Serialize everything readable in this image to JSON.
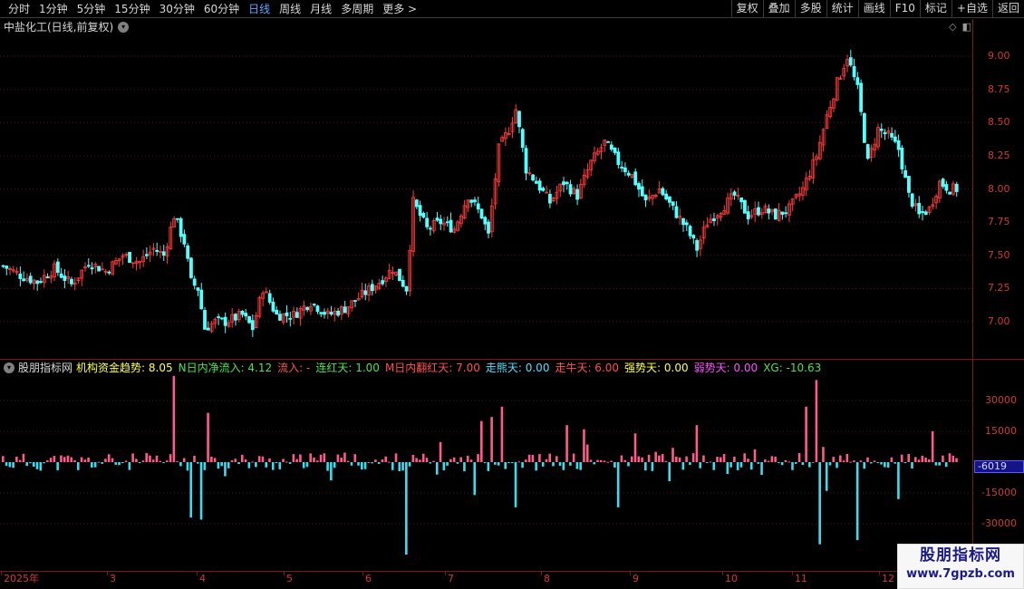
{
  "toolbar": {
    "periods": [
      "分时",
      "1分钟",
      "5分钟",
      "15分钟",
      "30分钟",
      "60分钟",
      "日线",
      "周线",
      "月线",
      "多周期",
      "更多 >"
    ],
    "active_period": 6,
    "tools": [
      "复权",
      "叠加",
      "多股",
      "统计",
      "画线",
      "F10",
      "标记",
      "+自选",
      "返回"
    ]
  },
  "main_title": "中盐化工(日线,前复权)",
  "colors": {
    "up": "#ff3c3c",
    "down": "#54ffff",
    "pos_bar": "#ff5a8c",
    "neg_bar": "#3cdcf0",
    "axis": "#d03a3a",
    "grid": "#5a1414"
  },
  "indicator": {
    "name": "股朋指标网",
    "items": [
      {
        "text": "机构资金趋势: 8.05",
        "color": "#ffff50"
      },
      {
        "text": "N日内净流入: 4.12",
        "color": "#50e050"
      },
      {
        "text": "流入: -",
        "color": "#ff5050"
      },
      {
        "text": "连红天: 1.00",
        "color": "#50e050"
      },
      {
        "text": "M日内翻红天: 7.00",
        "color": "#ff5050"
      },
      {
        "text": "走熊天: 0.00",
        "color": "#50e0ff"
      },
      {
        "text": "走牛天: 6.00",
        "color": "#ff5050"
      },
      {
        "text": "强势天: 0.00",
        "color": "#ffff50"
      },
      {
        "text": "弱势天: 0.00",
        "color": "#ff50ff"
      },
      {
        "text": "XG: -10.63",
        "color": "#50e050"
      }
    ]
  },
  "price_axis": [
    "9.00",
    "8.75",
    "8.50",
    "8.25",
    "8.00",
    "7.75",
    "7.50",
    "7.25",
    "7.00"
  ],
  "sub_axis": [
    "30000",
    "15000",
    "-15000",
    "-30000"
  ],
  "current_value": "-6019",
  "dates": [
    "2025年",
    "3",
    "4",
    "5",
    "6",
    "7",
    "8",
    "9",
    "10",
    "11",
    "12"
  ],
  "watermark": {
    "line1": "股朋指标网",
    "line2": "www.7gpzb.com"
  },
  "chart_data": {
    "type": "candlestick",
    "price_range": [
      6.72,
      9.28
    ],
    "closes_anchor": [
      [
        0,
        7.42
      ],
      [
        5,
        7.35
      ],
      [
        10,
        7.3
      ],
      [
        15,
        7.4
      ],
      [
        20,
        7.28
      ],
      [
        25,
        7.45
      ],
      [
        30,
        7.38
      ],
      [
        35,
        7.5
      ],
      [
        40,
        7.45
      ],
      [
        44,
        7.55
      ],
      [
        47,
        7.5
      ],
      [
        50,
        7.8
      ],
      [
        53,
        7.6
      ],
      [
        55,
        7.3
      ],
      [
        57,
        7.25
      ],
      [
        59,
        6.95
      ],
      [
        62,
        7.0
      ],
      [
        65,
        7.0
      ],
      [
        70,
        7.05
      ],
      [
        73,
        6.95
      ],
      [
        76,
        7.25
      ],
      [
        80,
        7.05
      ],
      [
        85,
        7.05
      ],
      [
        90,
        7.15
      ],
      [
        95,
        7.05
      ],
      [
        100,
        7.1
      ],
      [
        105,
        7.2
      ],
      [
        110,
        7.3
      ],
      [
        114,
        7.4
      ],
      [
        118,
        7.25
      ],
      [
        120,
        7.9
      ],
      [
        124,
        7.7
      ],
      [
        128,
        7.75
      ],
      [
        132,
        7.7
      ],
      [
        136,
        7.95
      ],
      [
        140,
        7.8
      ],
      [
        142,
        7.65
      ],
      [
        145,
        8.3
      ],
      [
        148,
        8.45
      ],
      [
        150,
        8.6
      ],
      [
        153,
        8.15
      ],
      [
        156,
        8.05
      ],
      [
        160,
        7.9
      ],
      [
        164,
        8.05
      ],
      [
        168,
        7.95
      ],
      [
        172,
        8.2
      ],
      [
        176,
        8.35
      ],
      [
        180,
        8.2
      ],
      [
        184,
        8.1
      ],
      [
        188,
        7.9
      ],
      [
        192,
        8.0
      ],
      [
        196,
        7.85
      ],
      [
        200,
        7.7
      ],
      [
        203,
        7.55
      ],
      [
        206,
        7.75
      ],
      [
        210,
        7.85
      ],
      [
        214,
        7.95
      ],
      [
        218,
        7.8
      ],
      [
        222,
        7.85
      ],
      [
        226,
        7.8
      ],
      [
        230,
        7.85
      ],
      [
        234,
        8.0
      ],
      [
        238,
        8.25
      ],
      [
        241,
        8.55
      ],
      [
        244,
        8.8
      ],
      [
        247,
        9.0
      ],
      [
        250,
        8.75
      ],
      [
        253,
        8.2
      ],
      [
        256,
        8.45
      ],
      [
        259,
        8.4
      ],
      [
        262,
        8.3
      ],
      [
        265,
        7.95
      ],
      [
        268,
        7.8
      ],
      [
        271,
        7.85
      ],
      [
        274,
        8.05
      ],
      [
        277,
        8.0
      ]
    ],
    "up_color": "#ff3c3c",
    "down_color": "#54ffff"
  }
}
